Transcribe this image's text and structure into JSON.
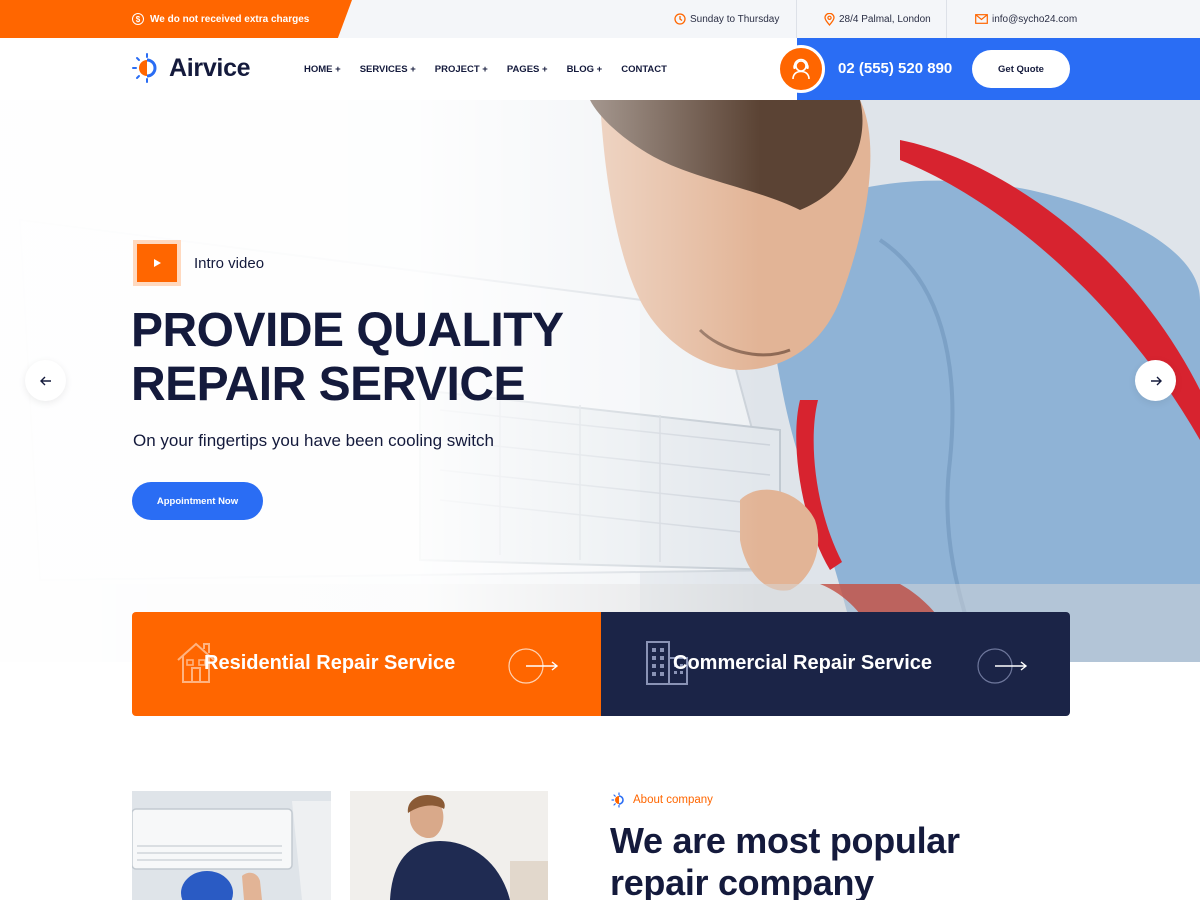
{
  "topbar": {
    "promo": "We do not received extra charges",
    "hours": "Sunday to Thursday",
    "address": "28/4 Palmal, London",
    "email": "info@sycho24.com"
  },
  "header": {
    "logo": "Airvice",
    "nav": [
      "HOME +",
      "SERVICES +",
      "PROJECT +",
      "PAGES +",
      "BLOG +",
      "CONTACT"
    ],
    "phone": "02 (555) 520 890",
    "quote_button": "Get Quote"
  },
  "hero": {
    "intro_label": "Intro video",
    "title_line1": "PROVIDE QUALITY",
    "title_line2": "REPAIR SERVICE",
    "subtitle": "On your fingertips you have been cooling switch",
    "cta": "Appointment Now"
  },
  "services": [
    {
      "title": "Residential Repair Service",
      "icon": "house-icon"
    },
    {
      "title": "Commercial Repair Service",
      "icon": "building-icon"
    }
  ],
  "about": {
    "tag": "About company",
    "title_line1": "We are most popular",
    "title_line2": "repair company"
  },
  "colors": {
    "accent_orange": "#ff6600",
    "accent_blue": "#2a6df4",
    "navy": "#1b2447",
    "text_dark": "#141a3c"
  }
}
